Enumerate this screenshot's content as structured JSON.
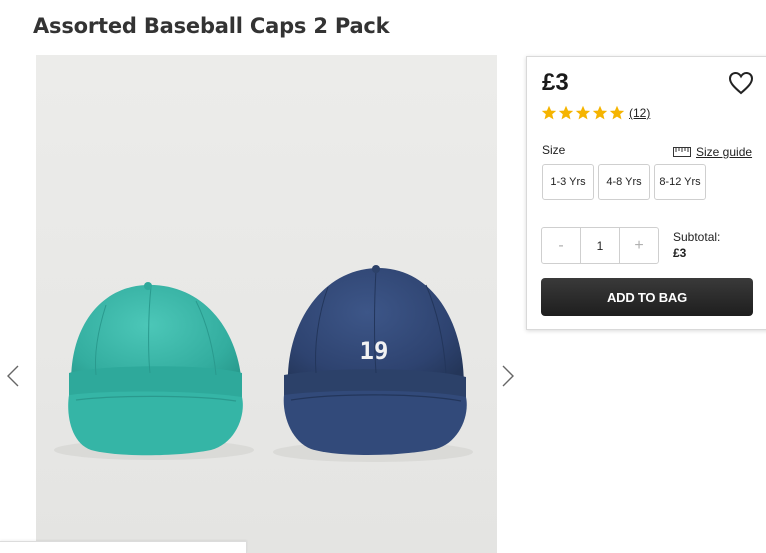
{
  "product": {
    "title": "Assorted Baseball Caps 2 Pack",
    "price": "£3",
    "rating": {
      "stars": 5,
      "max": 5,
      "count_label": "(12)"
    },
    "image_text": "19"
  },
  "size": {
    "label": "Size",
    "guide_label": "Size guide",
    "options": [
      "1-3 Yrs",
      "4-8 Yrs",
      "8-12 Yrs"
    ]
  },
  "quantity": {
    "minus": "-",
    "value": "1",
    "plus": "+"
  },
  "subtotal": {
    "label": "Subtotal:",
    "amount": "£3"
  },
  "actions": {
    "add_to_bag": "ADD TO BAG"
  },
  "colors": {
    "cap_teal": "#3cb5a8",
    "cap_navy": "#2f4470",
    "star": "#f5b400",
    "button": "#2a2a2a"
  },
  "icons": {
    "prev": "chevron-left-icon",
    "next": "chevron-right-icon",
    "wishlist": "heart-icon",
    "size_guide": "ruler-icon",
    "star": "star-icon"
  }
}
